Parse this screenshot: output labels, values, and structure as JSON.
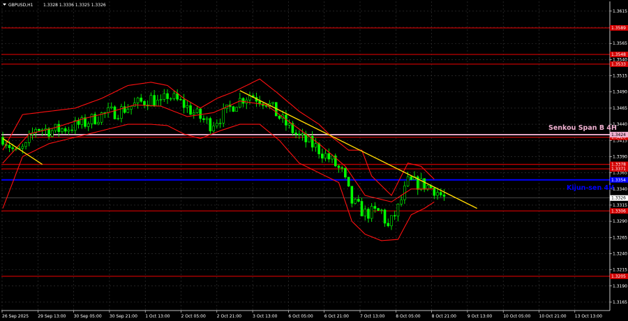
{
  "header": {
    "symbol": "GBPUSD,H1",
    "ohlc": "1.3328 1.3336 1.3325 1.3326"
  },
  "colors": {
    "background": "#000000",
    "grid": "#3a3a3a",
    "candle": "#00ff00",
    "ichimoku": "#ff1010",
    "level": "#c00000",
    "level_tag": "#d40000",
    "kijun": "#0000ff",
    "senkou": "#f0b0d0",
    "trendline": "#ffd700",
    "current_tag": "#ffffff"
  },
  "chart_data": {
    "type": "candlestick",
    "title": "",
    "ylim": [
      1.3152,
      1.363
    ],
    "y_ticks": [
      "1.3615",
      "1.3590",
      "1.3565",
      "1.3540",
      "1.3515",
      "1.3490",
      "1.3465",
      "1.3440",
      "1.3415",
      "1.3390",
      "1.3365",
      "1.3340",
      "1.3315",
      "1.3290",
      "1.3265",
      "1.3240",
      "1.3215",
      "1.3190",
      "1.3165"
    ],
    "x_ticks": [
      "26 Sep 2025",
      "29 Sep 13:00",
      "30 Sep 05:00",
      "30 Sep 21:00",
      "1 Oct 13:00",
      "2 Oct 05:00",
      "2 Oct 21:00",
      "3 Oct 13:00",
      "6 Oct 05:00",
      "6 Oct 21:00",
      "7 Oct 13:00",
      "8 Oct 05:00",
      "8 Oct 21:00",
      "9 Oct 13:00",
      "10 Oct 05:00",
      "10 Oct 21:00",
      "13 Oct 13:00"
    ],
    "levels": [
      {
        "price": 1.3589,
        "label": "1.3589"
      },
      {
        "price": 1.3548,
        "label": "1.3548"
      },
      {
        "price": 1.3533,
        "label": "1.3533"
      },
      {
        "price": 1.342,
        "label": "1.3420"
      },
      {
        "price": 1.3378,
        "label": "1.3378"
      },
      {
        "price": 1.3371,
        "label": "1.3371"
      },
      {
        "price": 1.3306,
        "label": "1.3306"
      },
      {
        "price": 1.3205,
        "label": "1.3205"
      }
    ],
    "senkou_span_b": {
      "price": 1.3424,
      "label": "1.3424",
      "annotation": "Senkou Span B 4H"
    },
    "kijun_sen": {
      "price": 1.3354,
      "label": "1.3354",
      "annotation": "Kijun-sen 4H"
    },
    "current_price": {
      "price": 1.3326,
      "label": "1.3326"
    },
    "trendlines": [
      {
        "points": [
          [
            0,
            1.3418
          ],
          [
            12,
            1.3378
          ]
        ]
      },
      {
        "points": [
          [
            72,
            1.3492
          ],
          [
            144,
            1.331
          ]
        ]
      }
    ],
    "close_anchors": [
      [
        0,
        1.342
      ],
      [
        4,
        1.3395
      ],
      [
        7,
        1.3405
      ],
      [
        10,
        1.3435
      ],
      [
        15,
        1.343
      ],
      [
        20,
        1.3435
      ],
      [
        25,
        1.3442
      ],
      [
        30,
        1.3455
      ],
      [
        35,
        1.346
      ],
      [
        40,
        1.347
      ],
      [
        45,
        1.348
      ],
      [
        48,
        1.347
      ],
      [
        50,
        1.3485
      ],
      [
        55,
        1.347
      ],
      [
        60,
        1.345
      ],
      [
        63,
        1.344
      ],
      [
        67,
        1.3455
      ],
      [
        71,
        1.3475
      ],
      [
        75,
        1.3486
      ],
      [
        80,
        1.3475
      ],
      [
        85,
        1.3445
      ],
      [
        90,
        1.342
      ],
      [
        95,
        1.3405
      ],
      [
        100,
        1.3383
      ],
      [
        103,
        1.3365
      ],
      [
        106,
        1.332
      ],
      [
        110,
        1.3302
      ],
      [
        115,
        1.3305
      ],
      [
        117,
        1.328
      ],
      [
        120,
        1.331
      ],
      [
        123,
        1.335
      ],
      [
        127,
        1.3348
      ],
      [
        131,
        1.334
      ],
      [
        134,
        1.3326
      ]
    ],
    "ichimoku_upper": [
      [
        0,
        1.34
      ],
      [
        6,
        1.3455
      ],
      [
        14,
        1.346
      ],
      [
        22,
        1.3465
      ],
      [
        30,
        1.348
      ],
      [
        38,
        1.35
      ],
      [
        45,
        1.3505
      ],
      [
        50,
        1.35
      ],
      [
        55,
        1.348
      ],
      [
        60,
        1.3465
      ],
      [
        65,
        1.348
      ],
      [
        70,
        1.349
      ],
      [
        78,
        1.351
      ],
      [
        83,
        1.349
      ],
      [
        90,
        1.346
      ],
      [
        96,
        1.344
      ],
      [
        100,
        1.342
      ],
      [
        105,
        1.34
      ],
      [
        109,
        1.34
      ],
      [
        112,
        1.336
      ],
      [
        118,
        1.333
      ],
      [
        123,
        1.338
      ],
      [
        127,
        1.3375
      ],
      [
        131,
        1.3355
      ]
    ],
    "ichimoku_mid": [
      [
        0,
        1.338
      ],
      [
        8,
        1.3425
      ],
      [
        16,
        1.3435
      ],
      [
        24,
        1.3448
      ],
      [
        32,
        1.3458
      ],
      [
        40,
        1.347
      ],
      [
        48,
        1.3468
      ],
      [
        56,
        1.3452
      ],
      [
        64,
        1.3458
      ],
      [
        72,
        1.3476
      ],
      [
        80,
        1.347
      ],
      [
        88,
        1.344
      ],
      [
        96,
        1.341
      ],
      [
        104,
        1.3375
      ],
      [
        110,
        1.333
      ],
      [
        118,
        1.332
      ],
      [
        124,
        1.334
      ],
      [
        131,
        1.334
      ]
    ],
    "ichimoku_lower": [
      [
        0,
        1.331
      ],
      [
        6,
        1.339
      ],
      [
        14,
        1.341
      ],
      [
        22,
        1.342
      ],
      [
        30,
        1.343
      ],
      [
        38,
        1.344
      ],
      [
        45,
        1.344
      ],
      [
        50,
        1.3438
      ],
      [
        55,
        1.3425
      ],
      [
        60,
        1.3418
      ],
      [
        66,
        1.343
      ],
      [
        72,
        1.344
      ],
      [
        78,
        1.344
      ],
      [
        84,
        1.3415
      ],
      [
        90,
        1.338
      ],
      [
        96,
        1.3365
      ],
      [
        102,
        1.335
      ],
      [
        106,
        1.329
      ],
      [
        110,
        1.327
      ],
      [
        115,
        1.326
      ],
      [
        120,
        1.3262
      ],
      [
        124,
        1.33
      ],
      [
        128,
        1.331
      ],
      [
        131,
        1.332
      ]
    ]
  }
}
